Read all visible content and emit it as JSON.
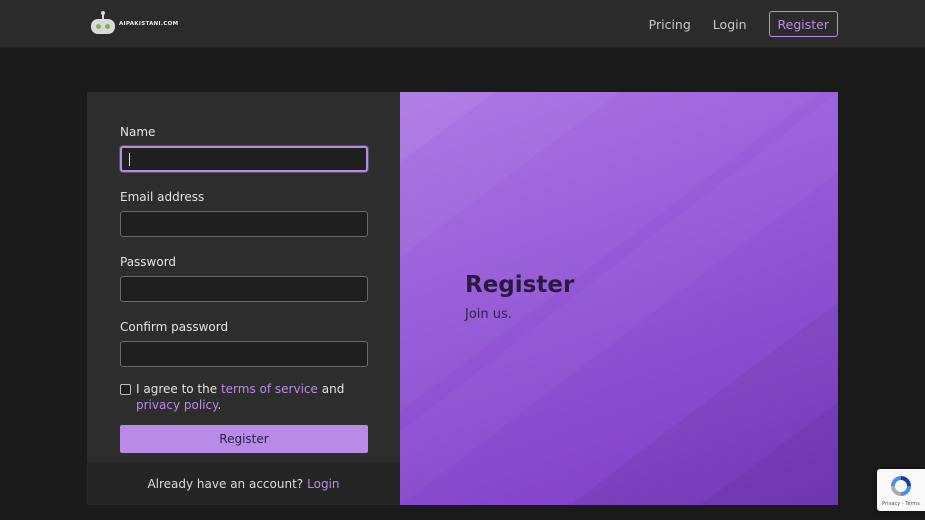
{
  "header": {
    "logo_text": "AIPAKISTANI.COM",
    "nav": {
      "pricing": "Pricing",
      "login": "Login",
      "register": "Register"
    }
  },
  "form": {
    "name_label": "Name",
    "email_label": "Email address",
    "password_label": "Password",
    "confirm_label": "Confirm password",
    "agree_prefix": "I agree to the",
    "terms_link": "terms of service",
    "agree_and": "and",
    "privacy_link": "privacy policy",
    "agree_suffix": ".",
    "submit_label": "Register",
    "footer_text": "Already have an account?",
    "footer_link": "Login"
  },
  "hero": {
    "title": "Register",
    "subtitle": "Join us."
  },
  "recaptcha": {
    "privacy": "Privacy",
    "separator": "-",
    "terms": "Terms"
  },
  "colors": {
    "accent": "#b98be8",
    "hero_start": "#a86ee3",
    "hero_end": "#7c3cc4",
    "background": "#1a1a1a",
    "panel": "#2d2d2d"
  }
}
